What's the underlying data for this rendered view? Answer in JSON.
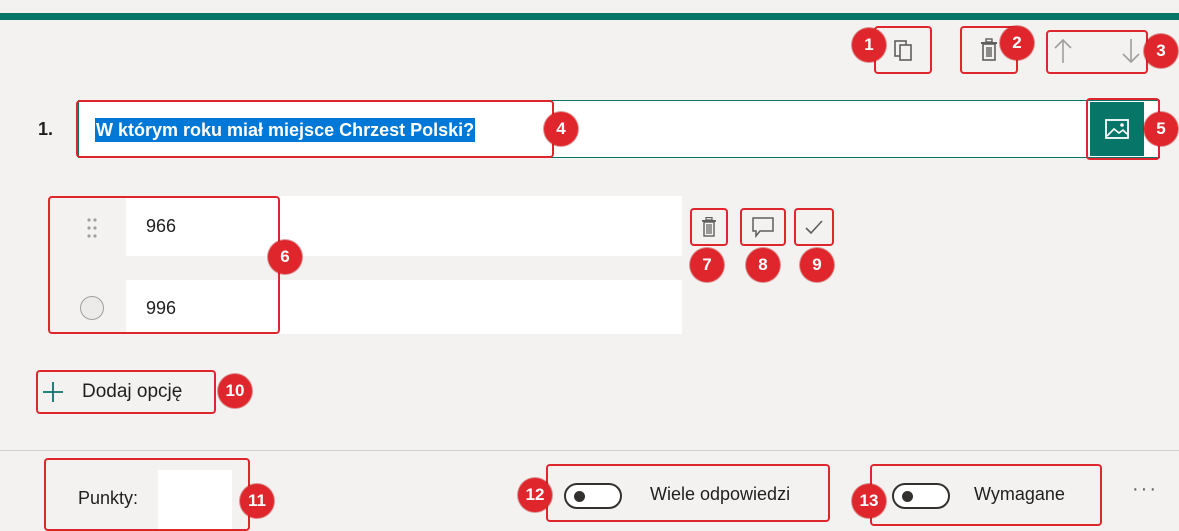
{
  "question": {
    "number": "1.",
    "text": "W którym roku miał miejsce Chrzest Polski?"
  },
  "options": [
    {
      "text": "966"
    },
    {
      "text": "996"
    }
  ],
  "add_option_label": "Dodaj opcję",
  "footer": {
    "points_label": "Punkty:",
    "points_value": "",
    "multiple_answers_label": "Wiele odpowiedzi",
    "required_label": "Wymagane",
    "more_label": "···"
  },
  "annotations": [
    "1",
    "2",
    "3",
    "4",
    "5",
    "6",
    "7",
    "8",
    "9",
    "10",
    "11",
    "12",
    "13"
  ],
  "colors": {
    "accent": "#077568",
    "highlight": "#0078d7",
    "annotation": "#e0262d"
  },
  "icons": [
    "copy-icon",
    "trash-icon",
    "arrow-up-icon",
    "arrow-down-icon",
    "image-icon",
    "drag-handle-icon",
    "radio-icon",
    "comment-icon",
    "checkmark-icon",
    "plus-icon",
    "more-icon"
  ]
}
